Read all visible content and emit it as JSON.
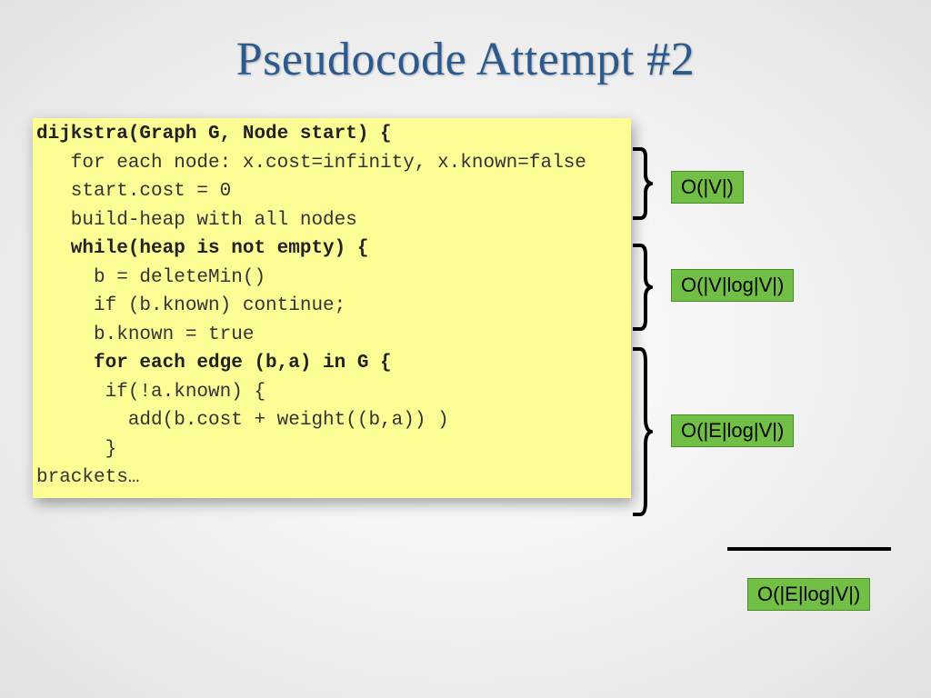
{
  "title": "Pseudocode Attempt #2",
  "code": {
    "l0": "dijkstra(Graph G, Node start) {",
    "l1": "   for each node: x.cost=infinity, x.known=false",
    "l2": "   start.cost = 0",
    "l3": "   build-heap with all nodes",
    "l4": "   while(heap is not empty) {",
    "l5": "     b = deleteMin()",
    "l6": "     if (b.known) continue;",
    "l7": "     b.known = true",
    "l8": "     for each edge (b,a) in G {",
    "l9": "      if(!a.known) {",
    "l10": "        add(b.cost + weight((b,a)) )",
    "l11": "      }",
    "l12": "brackets…"
  },
  "complexity": {
    "c1": "O(|V|)",
    "c2": "O(|V|log|V|)",
    "c3": "O(|E|log|V|)",
    "c4": "O(|E|log|V|)"
  }
}
